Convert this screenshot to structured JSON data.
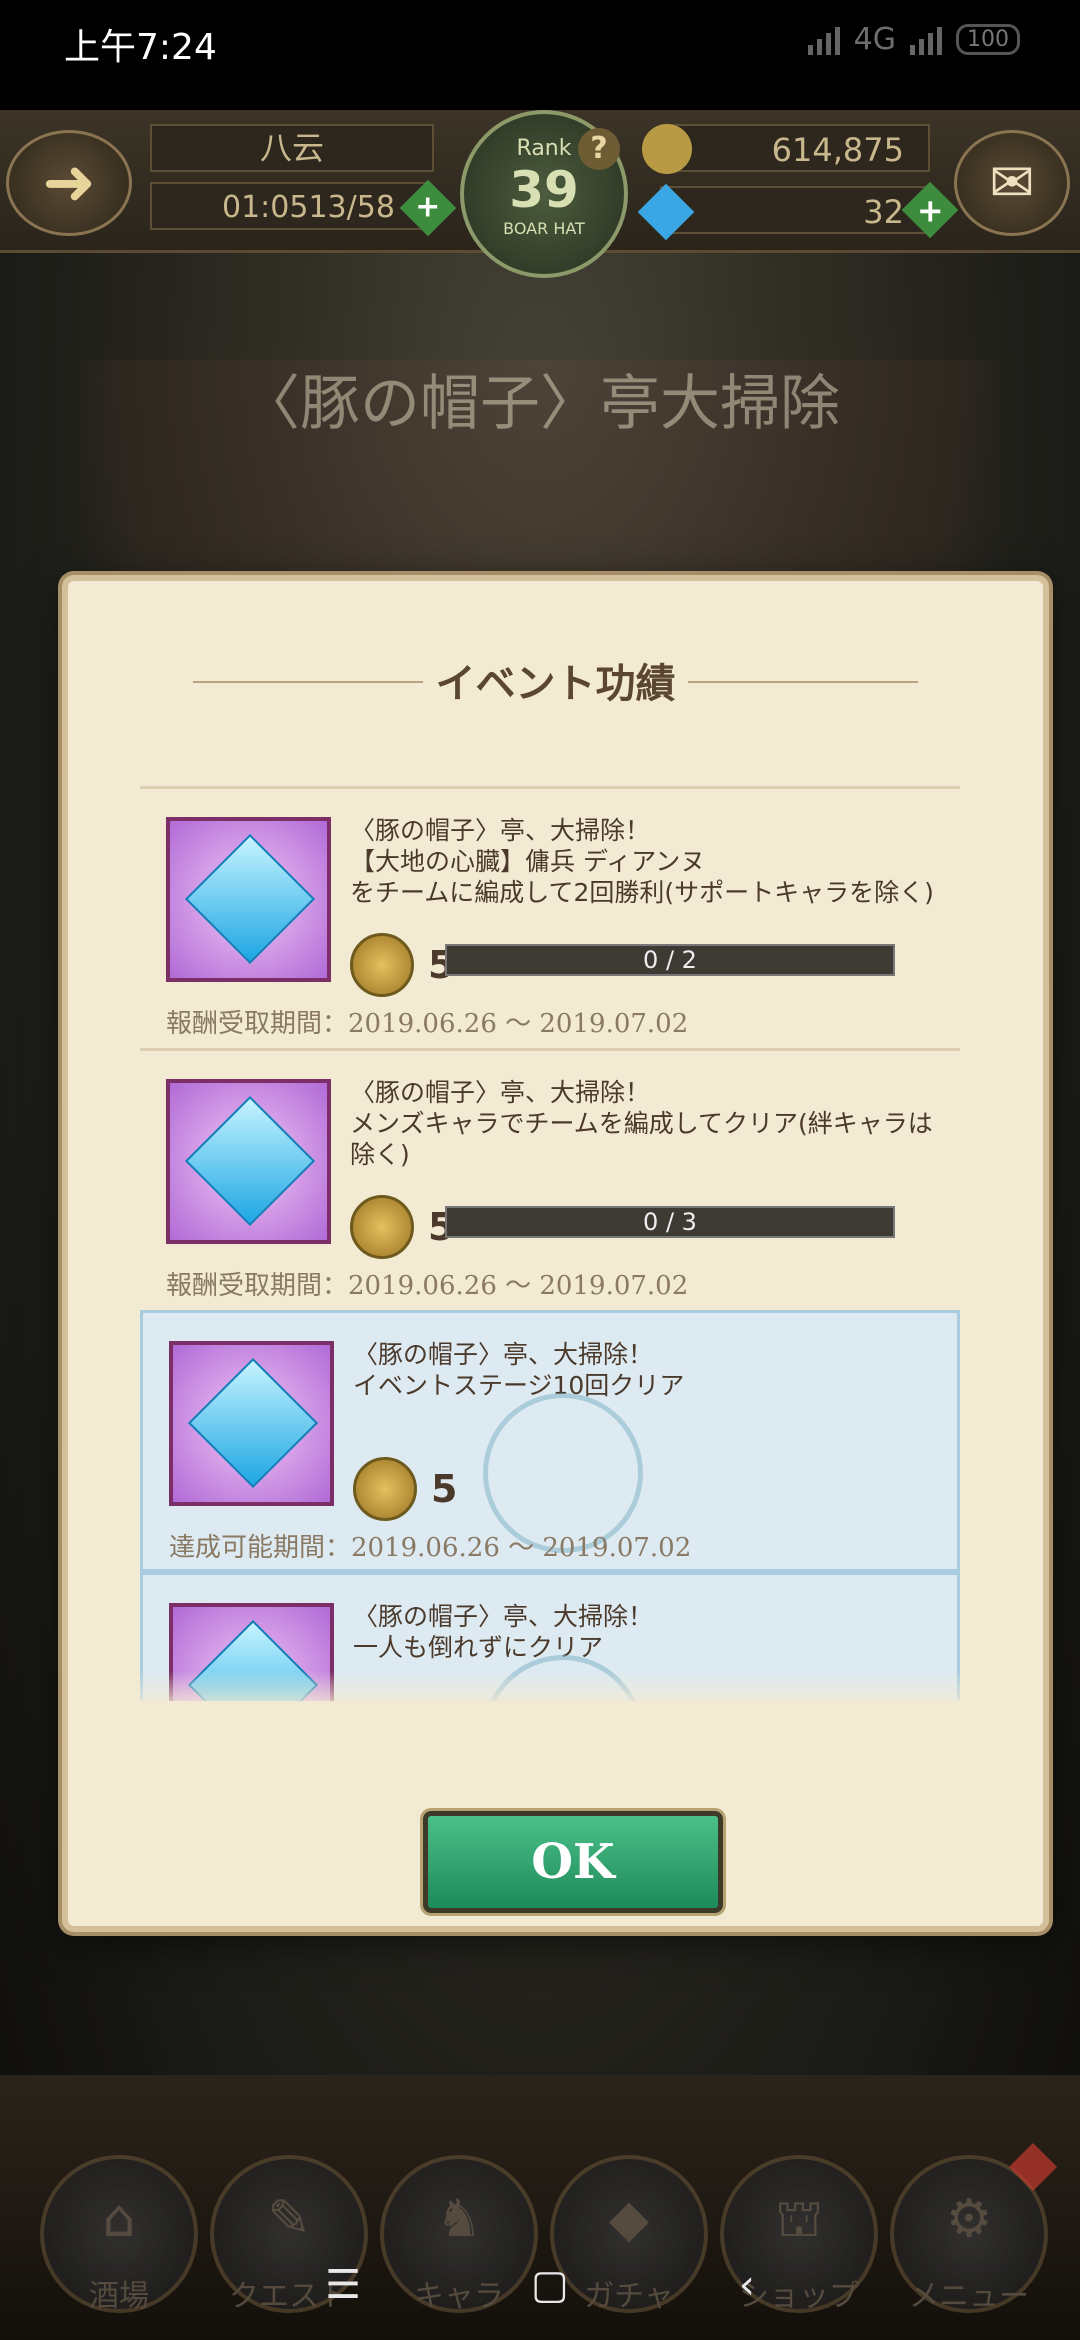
{
  "status": {
    "time": "上午7:24",
    "network": "4G",
    "battery": "100"
  },
  "hud": {
    "player_name": "八云",
    "stamina_timer": "01:05",
    "stamina": "13/58",
    "rank_label": "Rank",
    "rank_value": "39",
    "rank_sub": "BOAR HAT",
    "gold": "614,875",
    "gems": "32"
  },
  "event_title": "〈豚の帽子〉亭大掃除",
  "dialog": {
    "title": "イベント功績",
    "ok_label": "OK",
    "items": [
      {
        "desc": "〈豚の帽子〉亭、大掃除！\n【大地の心臓】傭兵 ディアンヌ\nをチームに編成して2回勝利(サポートキャラを除く)",
        "reward_qty": "5",
        "progress_text": "0 / 2",
        "period": "報酬受取期間：2019.06.26 ～ 2019.07.02",
        "done": false
      },
      {
        "desc": "〈豚の帽子〉亭、大掃除！\nメンズキャラでチームを編成してクリア(絆キャラは除く)",
        "reward_qty": "5",
        "progress_text": "0 / 3",
        "period": "報酬受取期間：2019.06.26 ～ 2019.07.02",
        "done": false
      },
      {
        "desc": "〈豚の帽子〉亭、大掃除！\nイベントステージ10回クリア",
        "reward_qty": "5",
        "progress_text": "",
        "period": "達成可能期間：2019.06.26 ～ 2019.07.02",
        "done": true
      },
      {
        "desc": "〈豚の帽子〉亭、大掃除！\n一人も倒れずにクリア",
        "reward_qty": "",
        "progress_text": "",
        "period": "",
        "done": true
      }
    ]
  },
  "bottom_nav": [
    "酒場",
    "クエスト",
    "キャラ",
    "ガチャ",
    "ショップ",
    "メニュー"
  ]
}
